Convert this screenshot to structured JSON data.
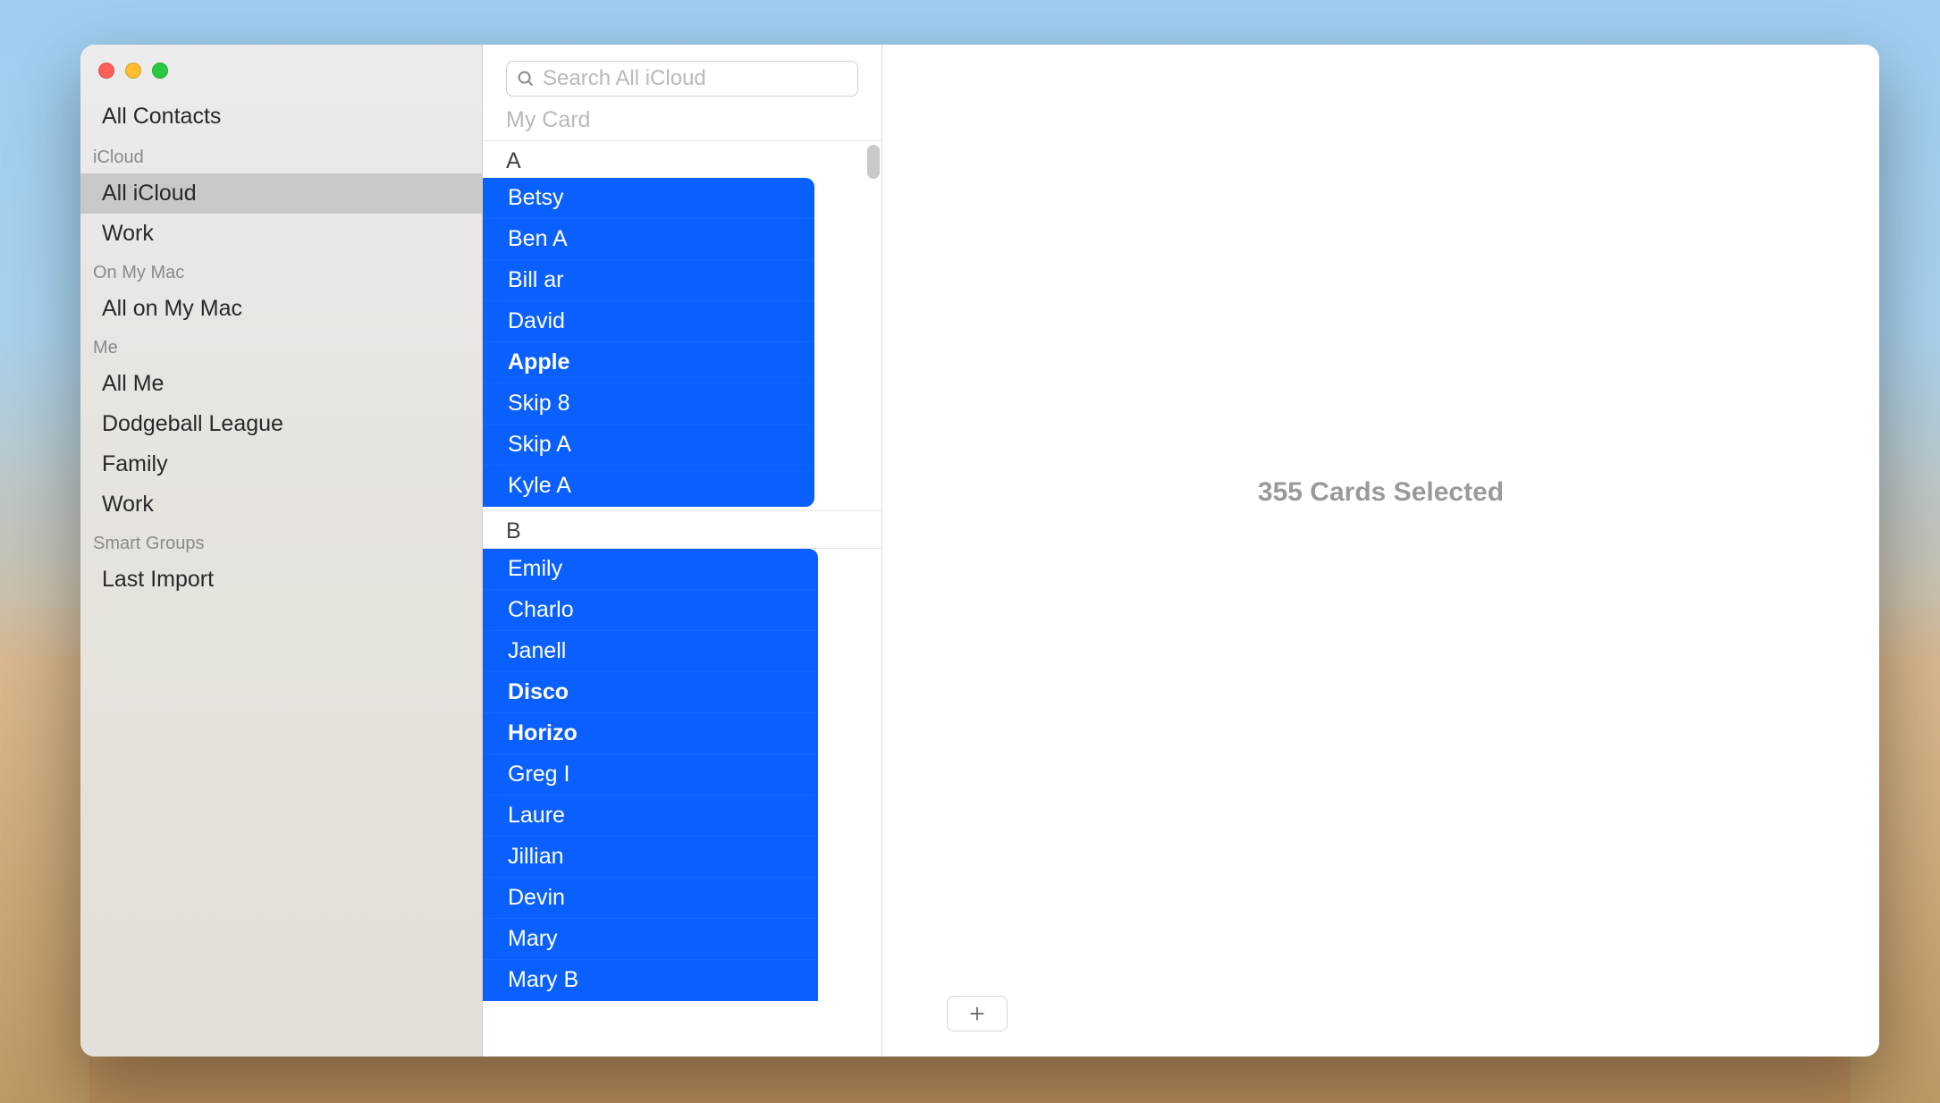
{
  "window": {
    "search_placeholder": "Search All iCloud",
    "my_card_label": "My Card"
  },
  "sidebar": {
    "top_item": "All Contacts",
    "sections": [
      {
        "header": "iCloud",
        "items": [
          {
            "label": "All iCloud",
            "selected": true
          },
          {
            "label": "Work",
            "selected": false
          }
        ]
      },
      {
        "header": "On My Mac",
        "items": [
          {
            "label": "All on My Mac",
            "selected": false
          }
        ]
      },
      {
        "header": "Me",
        "items": [
          {
            "label": "All Me",
            "selected": false
          },
          {
            "label": "Dodgeball League",
            "selected": false
          },
          {
            "label": "Family",
            "selected": false
          },
          {
            "label": "Work",
            "selected": false
          }
        ]
      },
      {
        "header": "Smart Groups",
        "items": [
          {
            "label": "Last Import",
            "selected": false
          }
        ]
      }
    ]
  },
  "contacts_list": {
    "sections": [
      {
        "letter": "A",
        "items": [
          {
            "name": "Betsy",
            "bold": false
          },
          {
            "name": "Ben A",
            "bold": false
          },
          {
            "name": "Bill ar",
            "bold": false
          },
          {
            "name": "David",
            "bold": false
          },
          {
            "name": "Apple",
            "bold": true
          },
          {
            "name": "Skip 8",
            "bold": false
          },
          {
            "name": "Skip A",
            "bold": false
          },
          {
            "name": "Kyle A",
            "bold": false
          }
        ]
      },
      {
        "letter": "B",
        "items": [
          {
            "name": "Emily",
            "bold": false
          },
          {
            "name": "Charlo",
            "bold": false
          },
          {
            "name": "Janell",
            "bold": false
          },
          {
            "name": "Disco",
            "bold": true
          },
          {
            "name": "Horizo",
            "bold": true
          },
          {
            "name": "Greg I",
            "bold": false
          },
          {
            "name": "Laure",
            "bold": false
          },
          {
            "name": "Jillian",
            "bold": false
          },
          {
            "name": "Devin",
            "bold": false
          },
          {
            "name": "Mary",
            "bold": false
          },
          {
            "name": "Mary B",
            "bold": false
          }
        ]
      }
    ]
  },
  "detail": {
    "selection_text": "355 Cards Selected"
  },
  "icons": {
    "add_button": "plus-icon",
    "search": "search-icon"
  }
}
